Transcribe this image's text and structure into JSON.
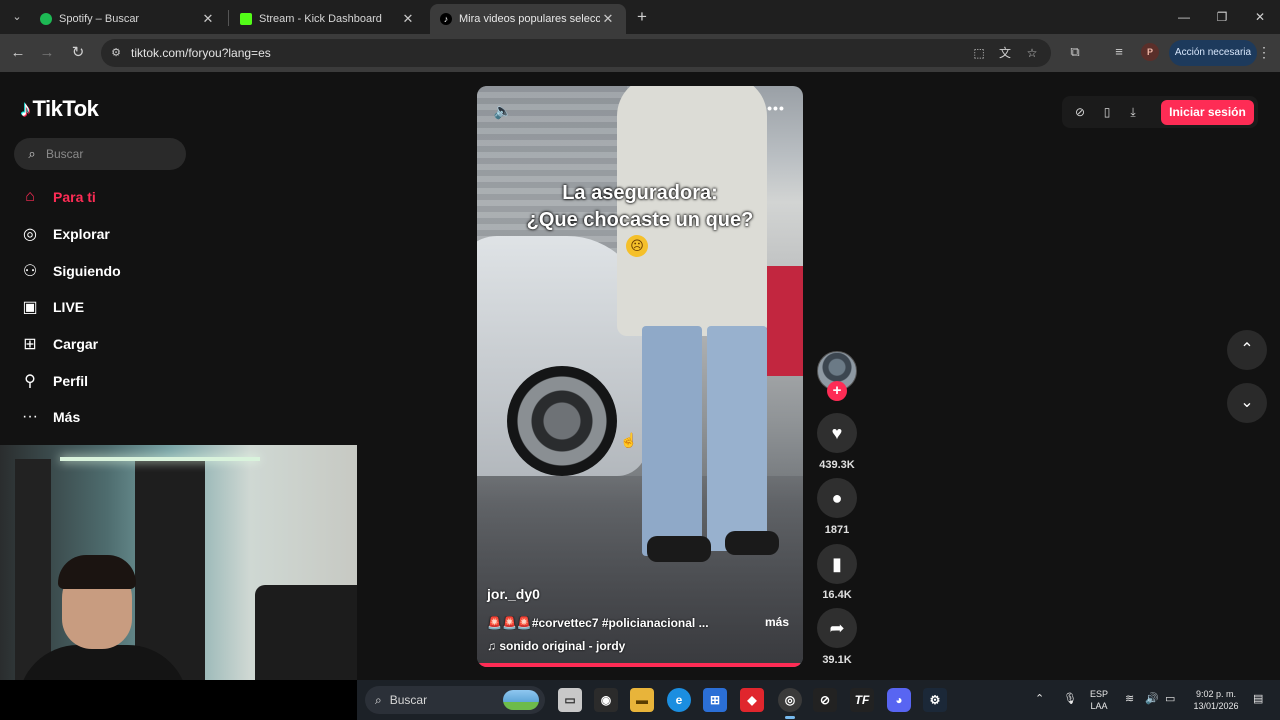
{
  "browser": {
    "tabs": [
      {
        "title": "Spotify – Buscar",
        "favicon_color": "#1db954"
      },
      {
        "title": "Stream - Kick Dashboard",
        "favicon_color": "#53fc18"
      },
      {
        "title": "Mira videos populares seleccion",
        "favicon_color": "#ffffff",
        "active": true
      }
    ],
    "url": "tiktok.com/foryou?lang=es",
    "action_button": "Acción necesaria",
    "profile_initial": "P"
  },
  "tiktok": {
    "logo_text": "TikTok",
    "search_placeholder": "Buscar",
    "nav": [
      {
        "label": "Para ti",
        "icon": "home-icon",
        "active": true
      },
      {
        "label": "Explorar",
        "icon": "compass-icon"
      },
      {
        "label": "Siguiendo",
        "icon": "following-icon"
      },
      {
        "label": "LIVE",
        "icon": "live-icon"
      },
      {
        "label": "Cargar",
        "icon": "upload-icon"
      },
      {
        "label": "Perfil",
        "icon": "profile-icon"
      },
      {
        "label": "Más",
        "icon": "more-icon"
      }
    ],
    "login_button": "Iniciar sesión",
    "video": {
      "caption_line1": "La aseguradora:",
      "caption_line2": "¿Que chocaste un que?",
      "username": "jor._dy0",
      "description": "🚨🚨🚨#corvettec7 #policianacional ...",
      "more_label": "más",
      "music": "sonido original - jordy",
      "progress": 0.99
    },
    "actions": {
      "likes": "439.3K",
      "comments": "1871",
      "saves": "16.4K",
      "shares": "39.1K"
    }
  },
  "taskbar": {
    "search_placeholder": "Buscar",
    "language_line1": "ESP",
    "language_line2": "LAA",
    "time": "9:02 p. m.",
    "date": "13/01/2026"
  },
  "colors": {
    "tiktok_accent": "#fe2c55",
    "page_bg": "#121212"
  }
}
